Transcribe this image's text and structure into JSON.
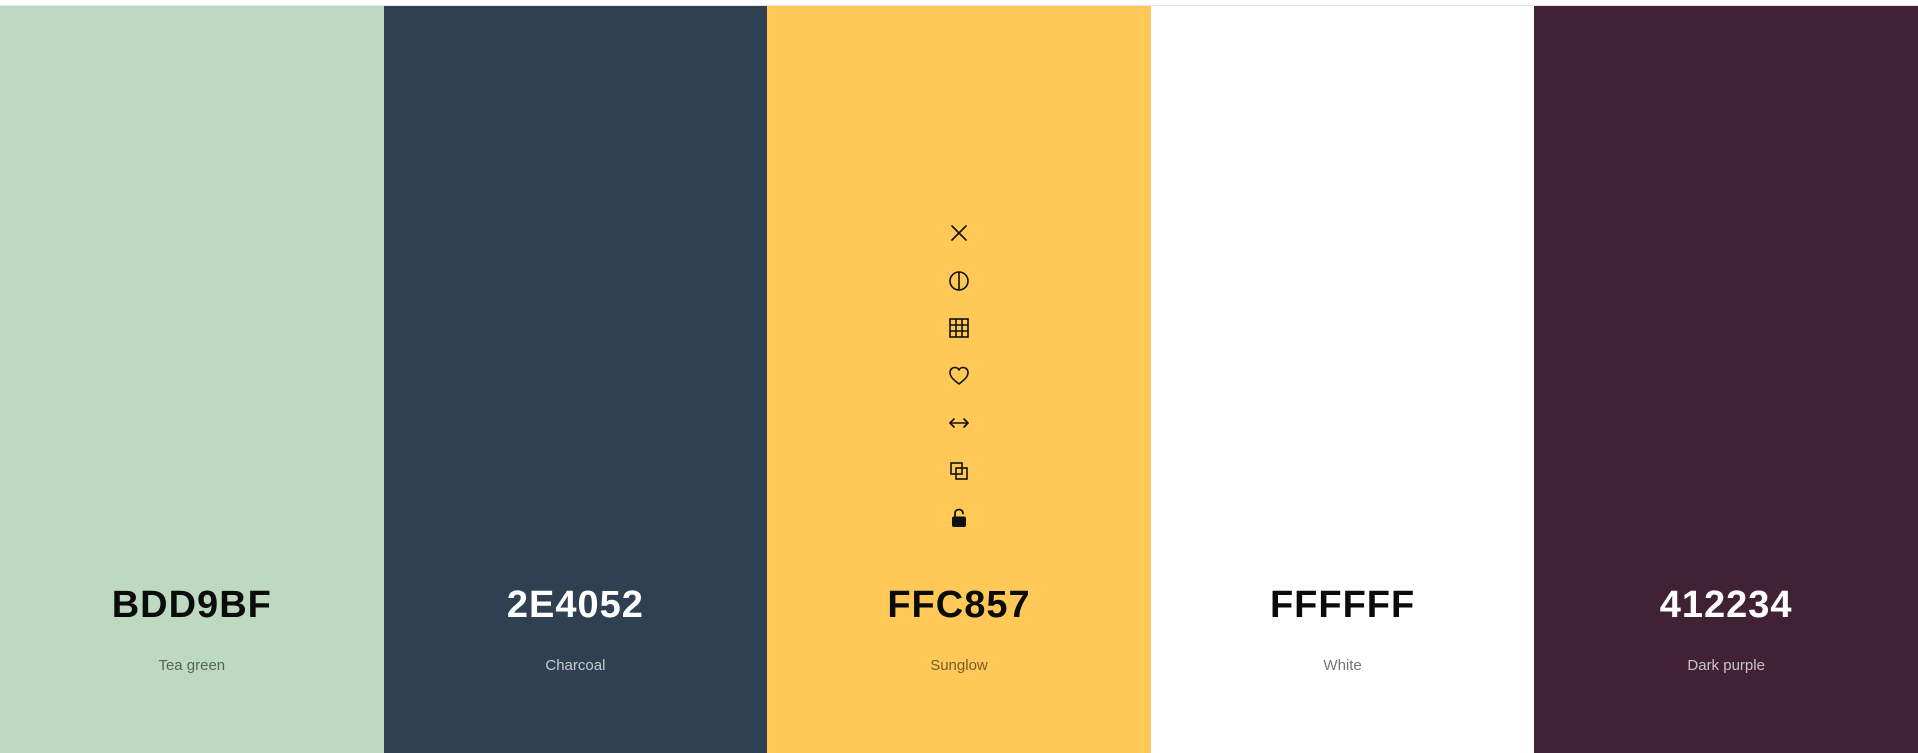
{
  "palette": {
    "colors": [
      {
        "hex": "BDD9BF",
        "name": "Tea green",
        "bg": "#BDD9BF",
        "tone": "light"
      },
      {
        "hex": "2E4052",
        "name": "Charcoal",
        "bg": "#2E4052",
        "tone": "dark"
      },
      {
        "hex": "FFC857",
        "name": "Sunglow",
        "bg": "#FFC857",
        "tone": "light"
      },
      {
        "hex": "FFFFFF",
        "name": "White",
        "bg": "#FFFFFF",
        "tone": "light"
      },
      {
        "hex": "412234",
        "name": "Dark purple",
        "bg": "#412234",
        "tone": "dark"
      }
    ]
  },
  "toolbar_icons": [
    "close-icon",
    "contrast-icon",
    "grid-icon",
    "heart-icon",
    "drag-horizontal-icon",
    "copy-icon",
    "unlock-icon"
  ]
}
